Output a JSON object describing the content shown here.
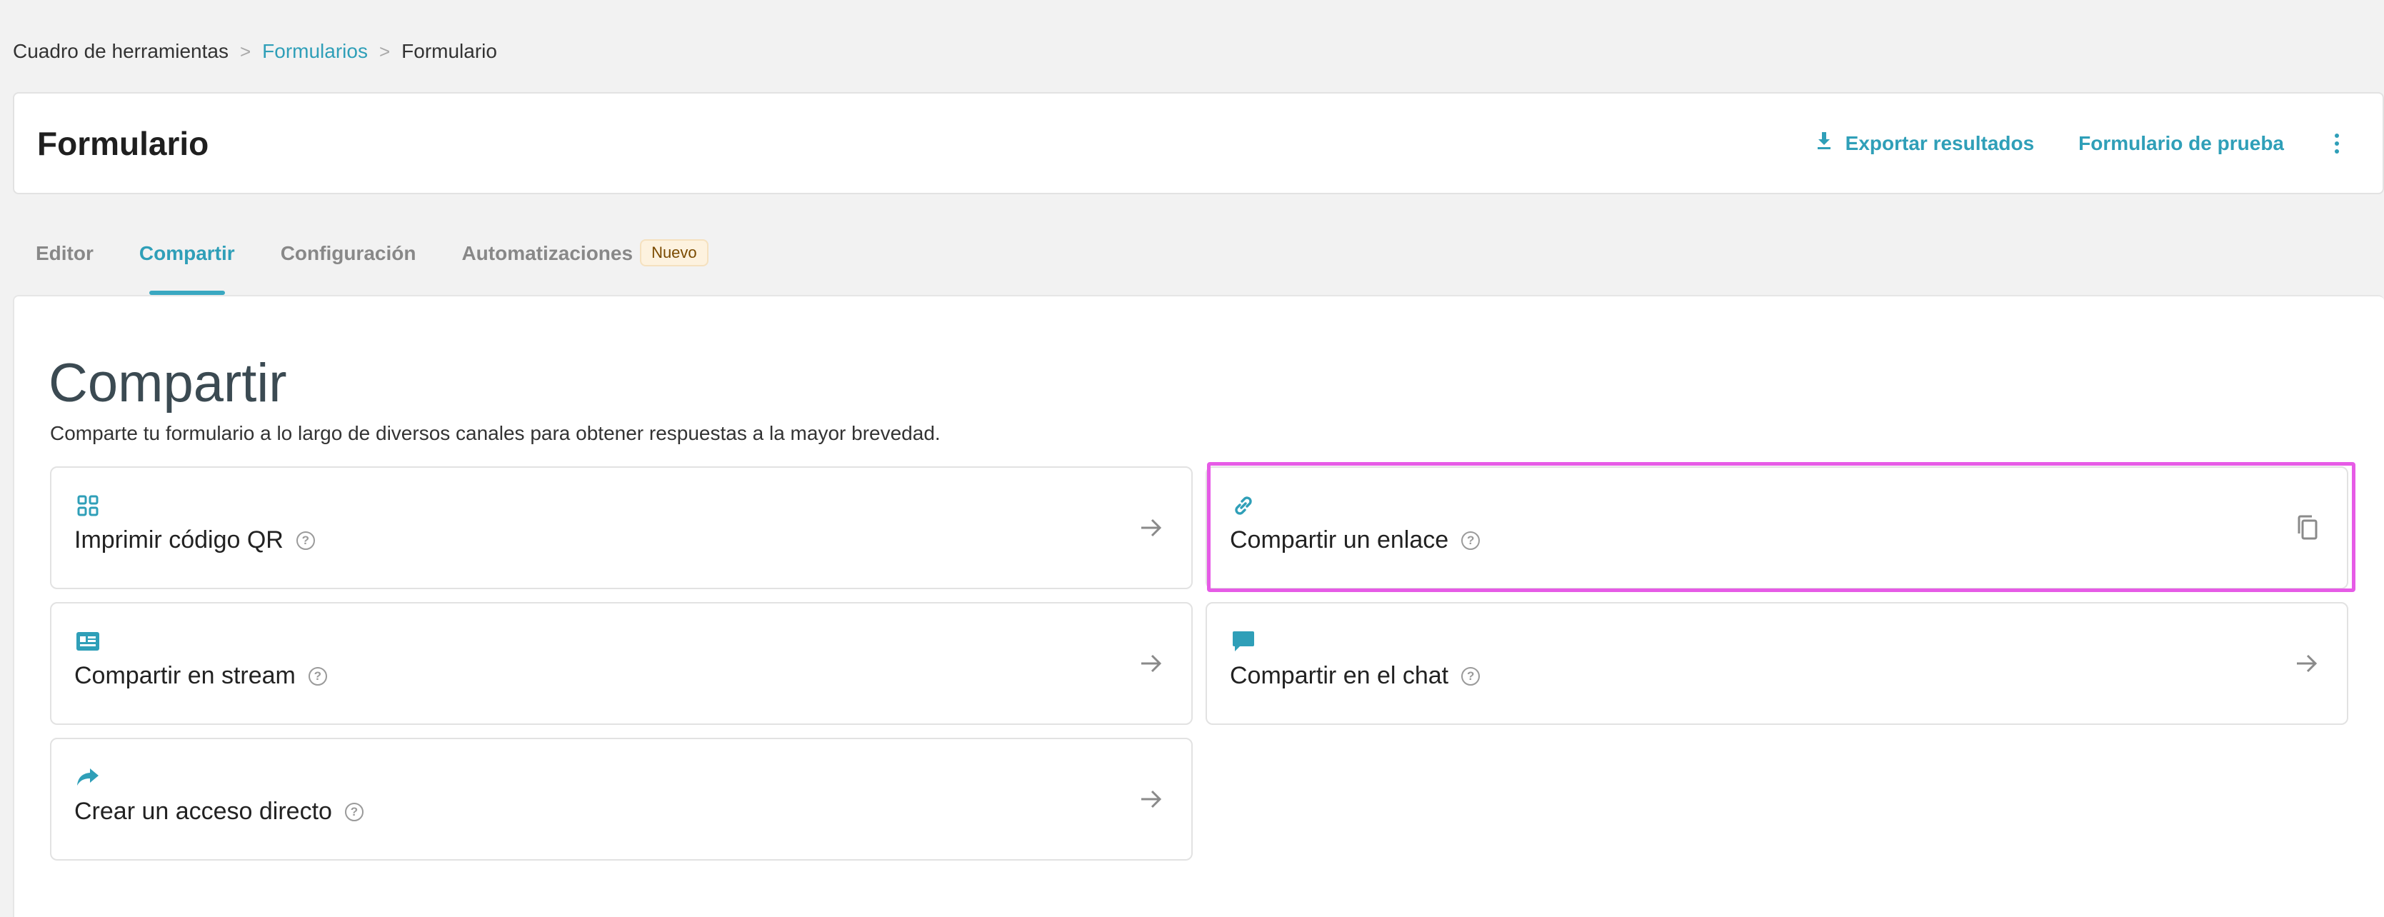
{
  "breadcrumb": {
    "items": [
      "Cuadro de herramientas",
      "Formularios",
      "Formulario"
    ],
    "separator": ">"
  },
  "header": {
    "title": "Formulario",
    "export_label": "Exportar resultados",
    "test_label": "Formulario de prueba"
  },
  "tabs": [
    {
      "label": "Editor"
    },
    {
      "label": "Compartir"
    },
    {
      "label": "Configuración"
    },
    {
      "label": "Automatizaciones",
      "badge": "Nuevo"
    }
  ],
  "share": {
    "title": "Compartir",
    "description": "Comparte tu formulario a lo largo de diversos canales para obtener respuestas a la mayor brevedad.",
    "options": [
      {
        "label": "Imprimir código QR",
        "icon": "qr-grid-icon",
        "trail": "arrow-right-icon"
      },
      {
        "label": "Compartir un enlace",
        "icon": "link-icon",
        "trail": "copy-icon"
      },
      {
        "label": "Compartir en stream",
        "icon": "stream-card-icon",
        "trail": "arrow-right-icon"
      },
      {
        "label": "Compartir en el chat",
        "icon": "chat-bubble-icon",
        "trail": "arrow-right-icon"
      },
      {
        "label": "Crear un acceso directo",
        "icon": "share-arrow-icon",
        "trail": "arrow-right-icon"
      }
    ]
  },
  "help_glyph": "?",
  "colors": {
    "accent": "#2f9fb8",
    "highlight": "#e65be6",
    "badge_bg": "#fdf2df"
  }
}
